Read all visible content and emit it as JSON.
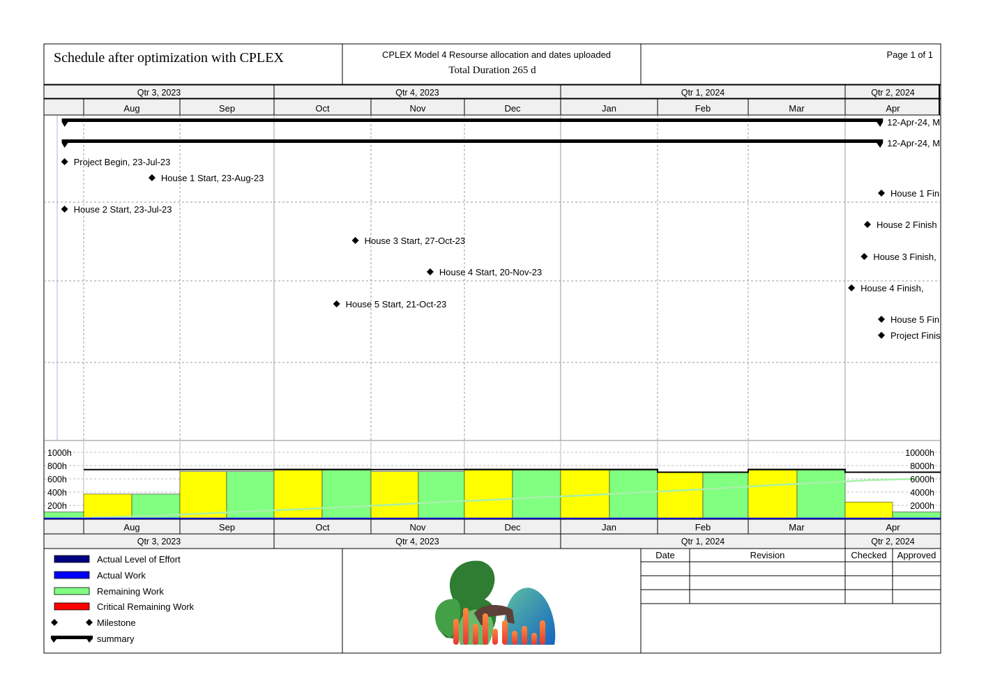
{
  "header": {
    "title": "Schedule after optimization with CPLEX",
    "model_line": "CPLEX Model 4 Resourse allocation and dates uploaded",
    "duration_line": "Total Duration 265 d",
    "page_label": "Page 1 of 1"
  },
  "timeline": {
    "quarters": [
      "Qtr 3, 2023",
      "Qtr 4, 2023",
      "Qtr 1, 2024",
      "Qtr 2, 2024"
    ],
    "months": [
      "Aug",
      "Sep",
      "Oct",
      "Nov",
      "Dec",
      "Jan",
      "Feb",
      "Mar",
      "Apr"
    ]
  },
  "summaries": [
    {
      "label": "12-Apr-24, M",
      "start": "2023-07-23",
      "end": "2024-04-12"
    },
    {
      "label": "12-Apr-24, M",
      "start": "2023-07-23",
      "end": "2024-04-12"
    }
  ],
  "milestones": [
    {
      "label": "Project Begin, 23-Jul-23",
      "date": "2023-07-23"
    },
    {
      "label": "House 1 Start, 23-Aug-23",
      "date": "2023-08-23"
    },
    {
      "label": "House 1 Fin",
      "date": "2024-04-12"
    },
    {
      "label": "House 2 Start, 23-Jul-23",
      "date": "2023-07-23"
    },
    {
      "label": "House 2 Finish",
      "date": "2024-04-08"
    },
    {
      "label": "House 3 Start, 27-Oct-23",
      "date": "2023-10-27"
    },
    {
      "label": "House 3 Finish,",
      "date": "2024-04-07"
    },
    {
      "label": "House 4 Start, 20-Nov-23",
      "date": "2023-11-20"
    },
    {
      "label": "House 4 Finish,",
      "date": "2024-04-03"
    },
    {
      "label": "House 5 Start, 21-Oct-23",
      "date": "2023-10-21"
    },
    {
      "label": "House 5 Fin",
      "date": "2024-04-12"
    },
    {
      "label": "Project Finis",
      "date": "2024-04-12"
    }
  ],
  "chart_data": {
    "type": "bar",
    "title": "",
    "y_left_ticks": [
      "1000h",
      "800h",
      "600h",
      "400h",
      "200h"
    ],
    "y_right_ticks": [
      "10000h",
      "8000h",
      "6000h",
      "4000h",
      "2000h"
    ],
    "ylim_left": [
      0,
      1000
    ],
    "ylim_right": [
      0,
      10000
    ],
    "periods": [
      "Jul",
      "Aug-1",
      "Aug-2",
      "Sep-1",
      "Sep-2",
      "Oct-1",
      "Oct-2",
      "Nov-1",
      "Nov-2",
      "Dec-1",
      "Dec-2",
      "Jan-1",
      "Jan-2",
      "Feb-1",
      "Feb-2",
      "Mar-1",
      "Mar-2",
      "Apr-1",
      "Apr-2"
    ],
    "series": [
      {
        "name": "Remaining Work",
        "values": [
          100,
          370,
          370,
          710,
          710,
          750,
          750,
          710,
          710,
          750,
          750,
          750,
          750,
          700,
          700,
          750,
          750,
          250,
          100
        ]
      },
      {
        "name": "Actual Level of Effort",
        "values": [
          0,
          0,
          0,
          0,
          0,
          0,
          0,
          0,
          0,
          0,
          0,
          0,
          0,
          0,
          0,
          0,
          0,
          0,
          0
        ]
      },
      {
        "name": "Actual Work",
        "values": [
          0,
          0,
          0,
          0,
          0,
          0,
          0,
          0,
          0,
          0,
          0,
          0,
          0,
          0,
          0,
          0,
          0,
          0,
          0
        ]
      }
    ],
    "cumulative_hours": [
      0,
      200,
      450,
      750,
      1100,
      1400,
      1750,
      2100,
      2500,
      2800,
      3200,
      3500,
      3900,
      4250,
      4600,
      5050,
      5400,
      5800,
      6000
    ],
    "capacity_hours": [
      740,
      740,
      740,
      740,
      740,
      740,
      740,
      740,
      740,
      740,
      740,
      740,
      740,
      700,
      700,
      740,
      740,
      700,
      700
    ],
    "colors": {
      "remaining": "#80ff80",
      "highlight": "#ffff00",
      "actual_effort": "#000080",
      "actual_work": "#0000ff",
      "critical": "#ff0000",
      "cumulative": "#a8f0a8"
    }
  },
  "legend": [
    {
      "label": "Actual Level of Effort",
      "color": "#000080",
      "kind": "bar"
    },
    {
      "label": "Actual Work",
      "color": "#0000ff",
      "kind": "bar"
    },
    {
      "label": "Remaining Work",
      "color": "#80ff80",
      "kind": "bar"
    },
    {
      "label": "Critical Remaining Work",
      "color": "#ff0000",
      "kind": "bar"
    },
    {
      "label": "Milestone",
      "color": "#000000",
      "kind": "milestone"
    },
    {
      "label": "summary",
      "color": "#000000",
      "kind": "summary"
    }
  ],
  "revision_table": {
    "headers": [
      "Date",
      "Revision",
      "Checked",
      "Approved"
    ]
  }
}
